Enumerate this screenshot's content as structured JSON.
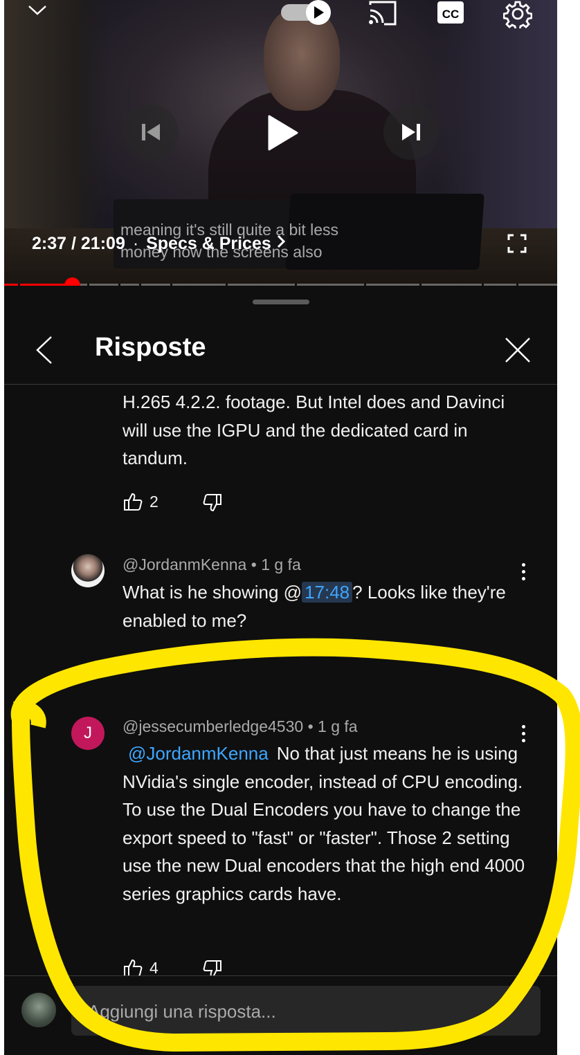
{
  "video": {
    "current_time": "2:37",
    "duration": "21:09",
    "chapter": "Specs & Prices",
    "caption_lines": [
      "meaning it's still quite a bit less",
      "money now the screens also"
    ],
    "progress": 0.1224,
    "autoplay_on": true,
    "icons": [
      "chevron-down-icon",
      "autoplay-toggle-icon",
      "cast-icon",
      "cc-icon",
      "gear-icon",
      "previous-icon",
      "play-icon",
      "next-icon",
      "fullscreen-icon"
    ]
  },
  "panel": {
    "title": "Risposte",
    "input_placeholder": "Aggiungi una risposta..."
  },
  "comments": [
    {
      "text": "H.265 4.2.2. footage.  But Intel does and Davinci will use the IGPU and the dedicated card in tandum.",
      "likes": "2"
    },
    {
      "author": "@JordanmKenna",
      "age": "1 g fa",
      "text_before": "What is he showing @",
      "timestamp": "17:48",
      "text_after": "? Looks like they're enabled to me?"
    },
    {
      "author": "@jessecumberledge4530",
      "age": "1 g fa",
      "avatar_letter": "J",
      "mention": "@JordanmKenna",
      "text": "No that just means he is using NVidia's single encoder, instead of CPU encoding.  To use the Dual Encoders you have to change the export speed to \"fast\" or \"faster\".  Those 2 setting use the new Dual encoders that the high end 4000 series graphics cards have.",
      "likes": "4"
    }
  ],
  "colors": {
    "background": "#0f0f0f",
    "progress": "#ff0000",
    "link": "#3ea6ff",
    "avatar_j": "#c2185b",
    "highlight": "#ffe600"
  }
}
